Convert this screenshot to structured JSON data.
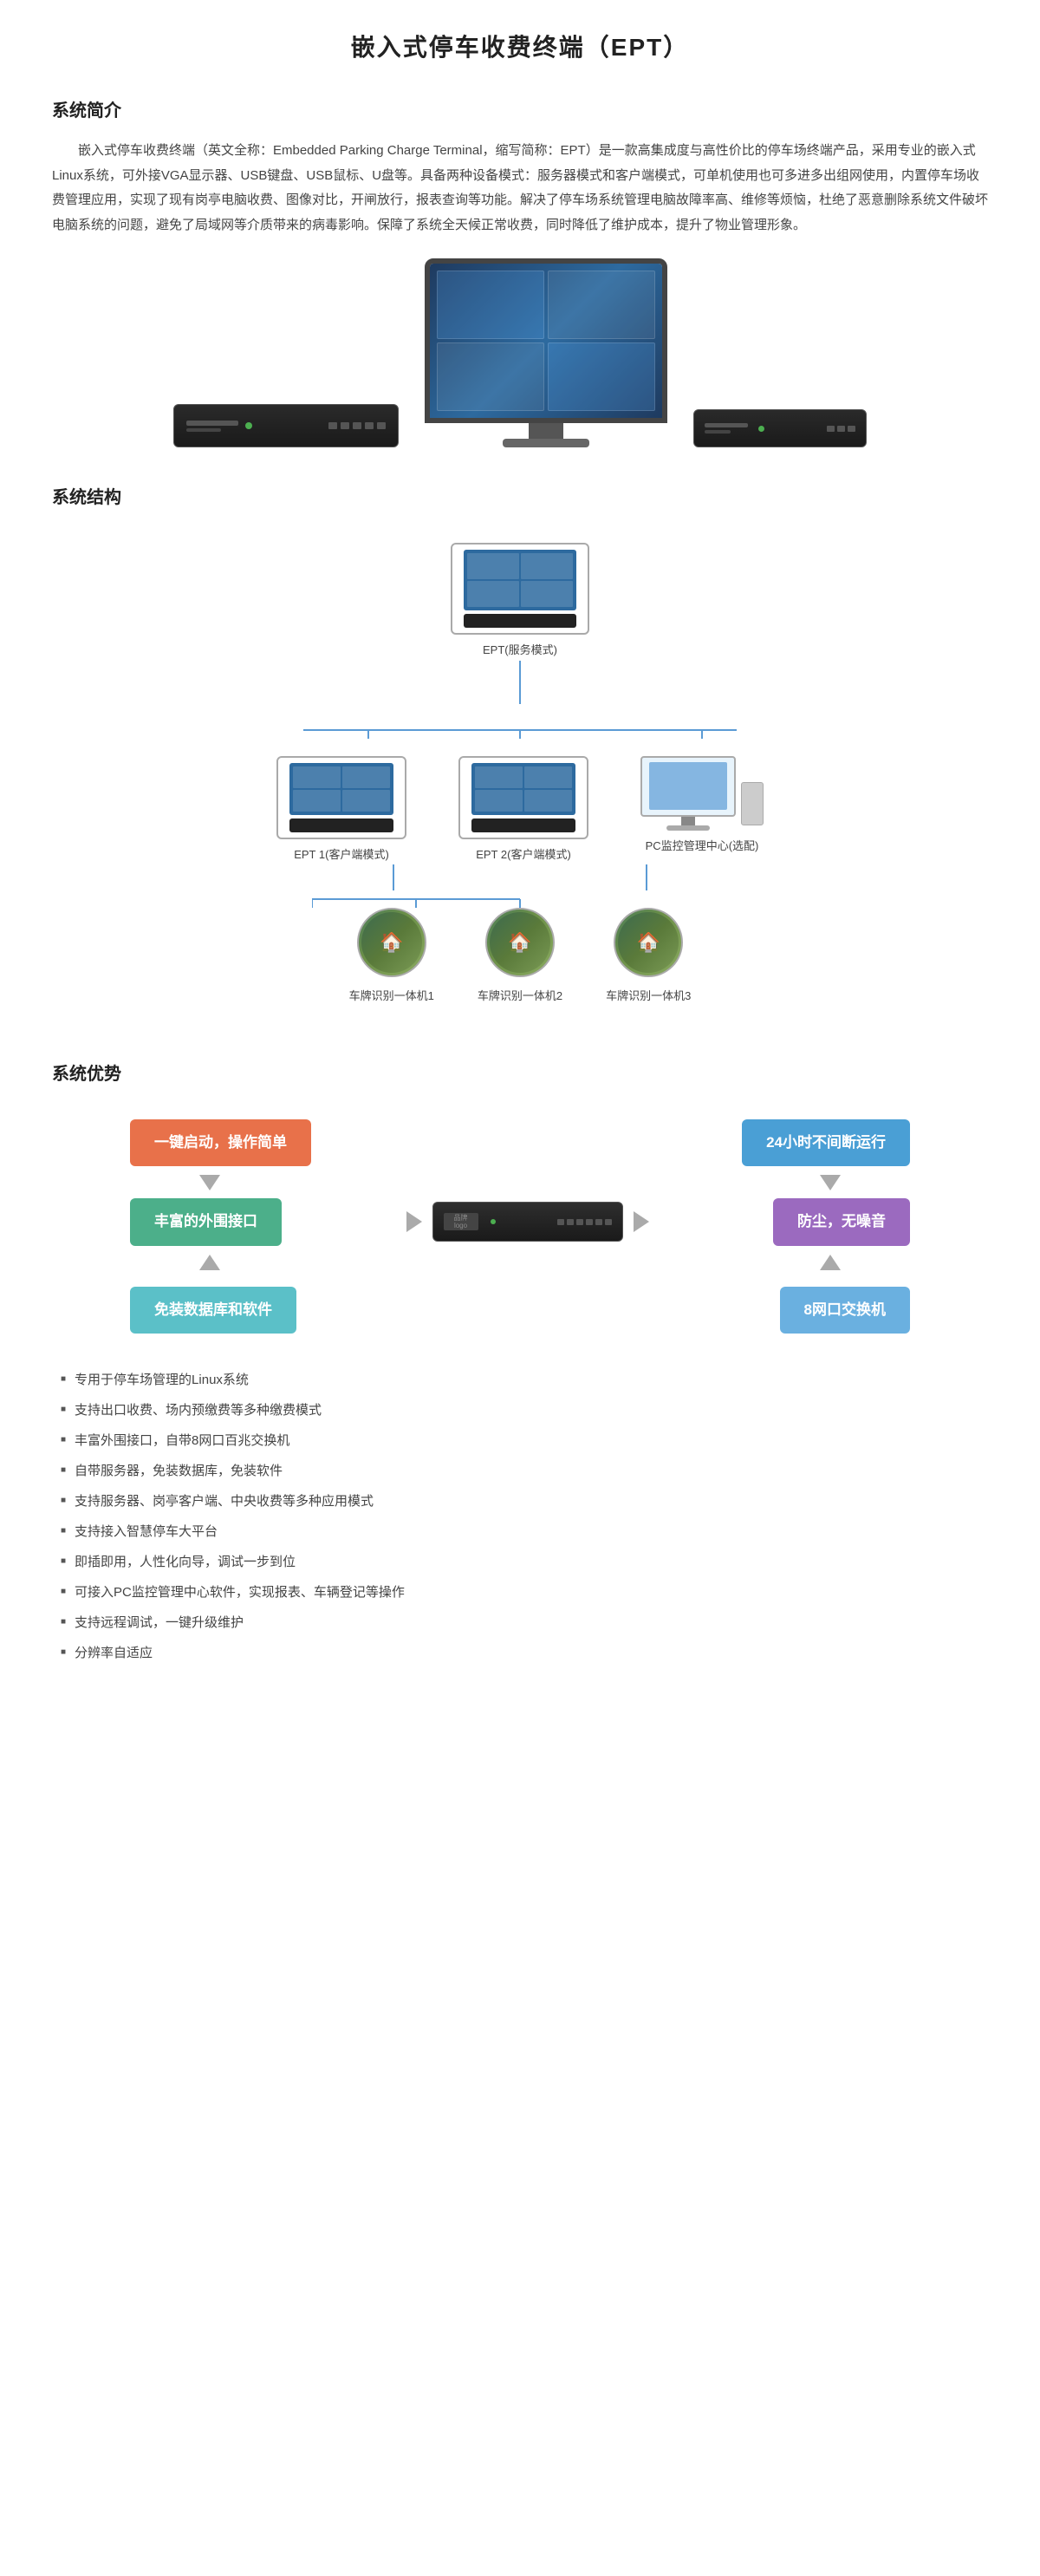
{
  "page": {
    "title": "嵌入式停车收费终端（EPT）"
  },
  "section_intro": {
    "heading": "系统简介",
    "text": "嵌入式停车收费终端（英文全称：Embedded Parking Charge Terminal，缩写简称：EPT）是一款高集成度与高性价比的停车场终端产品，采用专业的嵌入式Linux系统，可外接VGA显示器、USB键盘、USB鼠标、U盘等。具备两种设备模式：服务器模式和客户端模式，可单机使用也可多进多出组网使用，内置停车场收费管理应用，实现了现有岗亭电脑收费、图像对比，开闸放行，报表查询等功能。解决了停车场系统管理电脑故障率高、维修等烦恼，杜绝了恶意删除系统文件破坏电脑系统的问题，避免了局域网等介质带来的病毒影响。保障了系统全天候正常收费，同时降低了维护成本，提升了物业管理形象。"
  },
  "section_structure": {
    "heading": "系统结构",
    "server_label": "EPT(服务模式)",
    "client1_label": "EPT 1(客户端模式)",
    "client2_label": "EPT 2(客户端模式)",
    "pc_label": "PC监控管理中心(选配)",
    "cam1_label": "车牌识别一体机1",
    "cam2_label": "车牌识别一体机2",
    "cam3_label": "车牌识别一体机3"
  },
  "section_advantages": {
    "heading": "系统优势",
    "badge1": "一键启动，操作简单",
    "badge2": "24小时不间断运行",
    "badge3": "丰富的外围接口",
    "badge4": "防尘，无噪音",
    "badge5": "免装数据库和软件",
    "badge6": "8网口交换机"
  },
  "features": {
    "heading": "",
    "items": [
      "专用于停车场管理的Linux系统",
      "支持出口收费、场内预缴费等多种缴费模式",
      "丰富外围接口，自带8网口百兆交换机",
      "自带服务器，免装数据库，免装软件",
      "支持服务器、岗亭客户端、中央收费等多种应用模式",
      "支持接入智慧停车大平台",
      "即插即用，人性化向导，调试一步到位",
      "可接入PC监控管理中心软件，实现报表、车辆登记等操作",
      "支持远程调试，一键升级维护",
      "分辨率自适应"
    ]
  }
}
